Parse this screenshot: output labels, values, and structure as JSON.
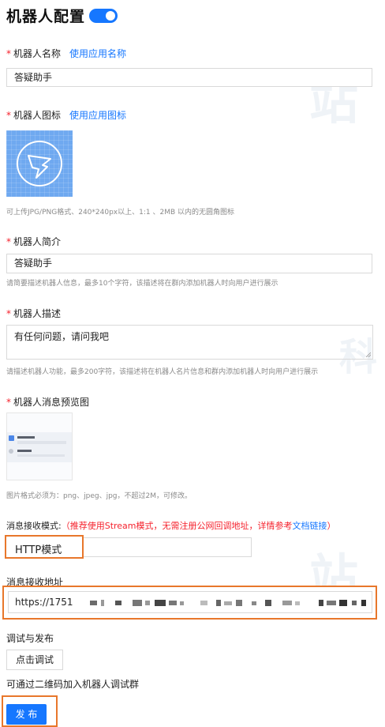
{
  "header": {
    "title": "机器人配置",
    "toggle_on": true
  },
  "name": {
    "label": "机器人名称",
    "use_app_link": "使用应用名称",
    "value": "答疑助手"
  },
  "icon": {
    "label": "机器人图标",
    "use_app_link": "使用应用图标",
    "hint": "可上传JPG/PNG格式、240*240px以上、1:1 、2MB 以内的无圆角图标",
    "icon_name": "dingtalk-logo-icon"
  },
  "intro": {
    "label": "机器人简介",
    "value": "答疑助手",
    "hint": "请简要描述机器人信息，最多10个字符，该描述将在群内添加机器人时向用户进行展示"
  },
  "desc": {
    "label": "机器人描述",
    "value": "有任何问题，请问我吧",
    "hint": "请描述机器人功能，最多200字符，该描述将在机器人名片信息和群内添加机器人时向用户进行展示"
  },
  "preview": {
    "label": "机器人消息预览图",
    "hint": "图片格式必须为：png、jpeg、jpg，不超过2M，可修改。"
  },
  "receive_mode": {
    "label": "消息接收模式:",
    "note": "（推荐使用Stream模式，无需注册公网回调地址，详情参考",
    "doc_link": "文档链接",
    "note_end": "）",
    "value": "HTTP模式"
  },
  "receive_url": {
    "label": "消息接收地址",
    "value": "https://1751"
  },
  "debug": {
    "label": "调试与发布",
    "button": "点击调试",
    "qr_hint": "可通过二维码加入机器人调试群"
  },
  "publish": {
    "button": "发 布"
  },
  "colors": {
    "accent": "#1677ff",
    "required": "#f5222d",
    "highlight": "#e8772b"
  }
}
